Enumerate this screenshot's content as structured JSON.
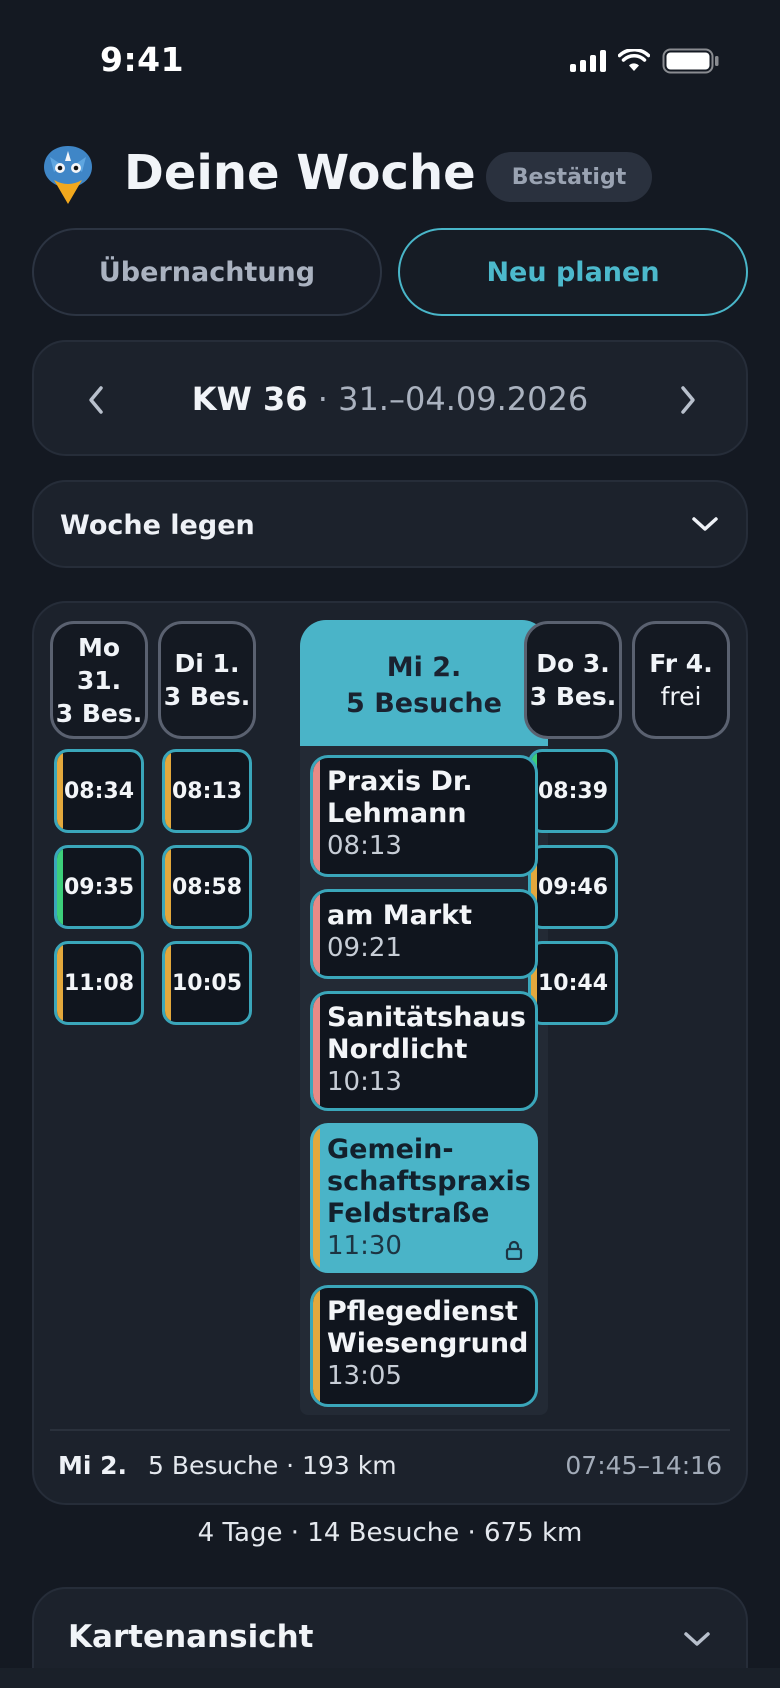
{
  "status_bar": {
    "time": "9:41",
    "icons": [
      "signal-icon",
      "wifi-icon",
      "battery-icon"
    ]
  },
  "header": {
    "title": "Deine Woche",
    "badge": "Bestätigt",
    "logo_icon": "bird-logo-icon"
  },
  "actions": {
    "overnight": "Übernachtung",
    "replan": "Neu planen"
  },
  "week_nav": {
    "kw": "KW 36",
    "separator": "·",
    "range": "31.–04.09.2026",
    "prev_icon": "chevron-left-icon",
    "next_icon": "chevron-right-icon"
  },
  "woche_legen": {
    "label": "Woche legen",
    "icon": "chevron-down-icon"
  },
  "days": [
    {
      "line1": "Mo",
      "line2": "31.",
      "line3": "3 Bes."
    },
    {
      "line1": "Di 1.",
      "line2": "3 Bes."
    },
    {
      "line1": "Mi 2.",
      "line2": "5 Besuche",
      "selected": true
    },
    {
      "line1": "Do 3.",
      "line2": "3 Bes."
    },
    {
      "line1": "Fr 4.",
      "line2": "frei"
    }
  ],
  "chips": {
    "mo": [
      {
        "time": "08:34",
        "color": "#e3a83c"
      },
      {
        "time": "09:35",
        "color": "#3ccf7a"
      },
      {
        "time": "11:08",
        "color": "#e3a83c"
      }
    ],
    "di": [
      {
        "time": "08:13",
        "color": "#e3a83c"
      },
      {
        "time": "08:58",
        "color": "#e3a83c"
      },
      {
        "time": "10:05",
        "color": "#e3a83c"
      }
    ],
    "do": [
      {
        "time": "08:39",
        "color": "#3ccf7a"
      },
      {
        "time": "09:46",
        "color": "#e3a83c"
      },
      {
        "time": "10:44",
        "color": "#e3a83c"
      }
    ]
  },
  "visits": [
    {
      "name1": "Praxis Dr.",
      "name2": "Lehmann",
      "time": "08:13",
      "color": "#e88a86"
    },
    {
      "name1": "am Markt",
      "time": "09:21",
      "color": "#e88a86"
    },
    {
      "name1": "Sanitätshaus",
      "name2": "Nordlicht",
      "time": "10:13",
      "color": "#e88a86"
    },
    {
      "name1": "Gemein-",
      "name2": "schaftspraxis",
      "name3": "Feldstraße",
      "time": "11:30",
      "color": "#e3a83c",
      "locked": true
    },
    {
      "name1": "Pflegedienst",
      "name2": "Wiesengrund",
      "time": "13:05",
      "color": "#e3a83c"
    }
  ],
  "day_footer": {
    "day": "Mi 2.",
    "stats": "5 Besuche · 193 km",
    "time_range": "07:45–14:16"
  },
  "week_summary": "4 Tage · 14 Besuche · 675 km",
  "kartenansicht": {
    "label": "Kartenansicht",
    "icon": "chevron-down-icon"
  },
  "colors": {
    "accent": "#4ab4c8",
    "background": "#141922",
    "card": "#1c222c",
    "amber": "#e3a83c",
    "green": "#3ccf7a",
    "salmon": "#e88a86"
  }
}
